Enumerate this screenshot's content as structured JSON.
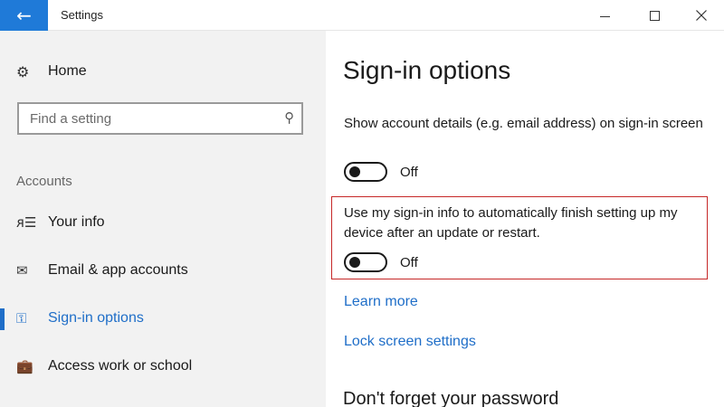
{
  "window": {
    "title": "Settings",
    "back_icon": "←"
  },
  "sidebar": {
    "home_label": "Home",
    "home_icon": "⚙",
    "search_placeholder": "Find a setting",
    "search_icon": "⚲",
    "section_label": "Accounts",
    "items": [
      {
        "label": "Your info",
        "icon": "ᴙ☰",
        "active": false
      },
      {
        "label": "Email & app accounts",
        "icon": "✉",
        "active": false
      },
      {
        "label": "Sign-in options",
        "icon": "⚿",
        "active": true
      },
      {
        "label": "Access work or school",
        "icon": "💼",
        "active": false
      }
    ]
  },
  "main": {
    "title": "Sign-in options",
    "setting1": {
      "description": "Show account details (e.g. email address) on sign-in screen",
      "toggle_label": "Off"
    },
    "setting2": {
      "description": "Use my sign-in info to automatically finish setting up my device after an update or restart.",
      "toggle_label": "Off"
    },
    "links": {
      "learn_more": "Learn more",
      "lock_screen": "Lock screen settings"
    },
    "subheading": "Don't forget your password"
  },
  "colors": {
    "accent": "#1f6ec8",
    "back_button": "#1f7ad8",
    "highlight_border": "#c62828"
  }
}
